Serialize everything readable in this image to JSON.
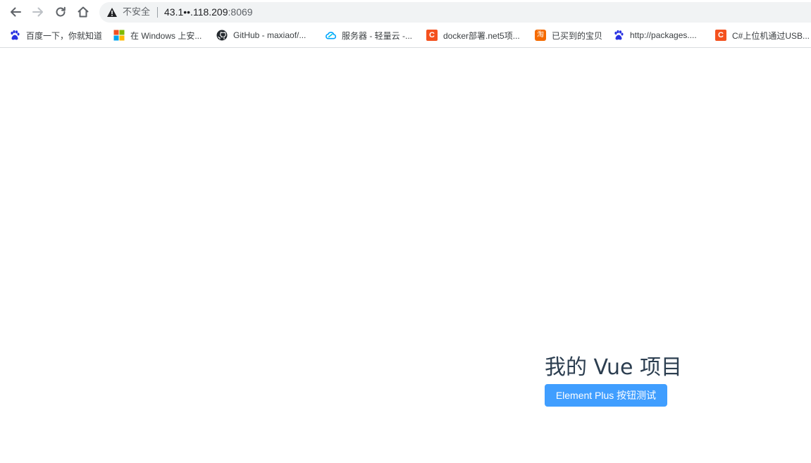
{
  "toolbar": {
    "security_label": "不安全",
    "url_host": "43.1••.118.209",
    "url_port": ":8069"
  },
  "bookmarks": [
    {
      "label": "百度一下，你就知道",
      "icon": "baidu-paw-icon"
    },
    {
      "label": "在 Windows 上安...",
      "icon": "windows-logo-icon"
    },
    {
      "label": "GitHub - maxiaof/...",
      "icon": "github-icon"
    },
    {
      "label": "服务器 - 轻量云 -...",
      "icon": "cloud-icon"
    },
    {
      "label": "docker部署.net5项...",
      "icon": "csdn-c-icon"
    },
    {
      "label": "已买到的宝贝",
      "icon": "taobao-icon"
    },
    {
      "label": "http://packages....",
      "icon": "baidu-paw-icon"
    },
    {
      "label": "C#上位机通过USB...",
      "icon": "csdn-c-icon"
    }
  ],
  "icon_glyphs": {
    "csdn": "C",
    "taobao": "淘"
  },
  "app": {
    "title": "我的 Vue 项目",
    "button_label": "Element Plus 按钮测试"
  },
  "colors": {
    "button_primary": "#409eff",
    "title_text": "#2c3e50",
    "omnibox_bg": "#f1f3f4",
    "csdn_red": "#f4511e",
    "taobao_orange": "#f56a00"
  }
}
